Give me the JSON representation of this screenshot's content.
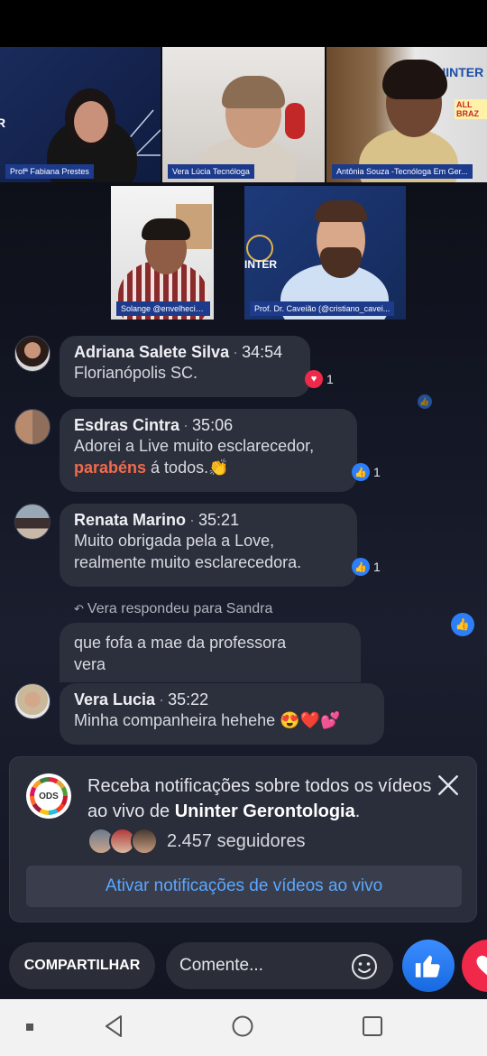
{
  "videos": [
    {
      "label": "Profª Fabiana Prestes"
    },
    {
      "label": "Vera Lúcia Tecnóloga"
    },
    {
      "label": "Antônia Souza -Tecnóloga Em Ger..."
    },
    {
      "label": "Solange @envelheciativo"
    },
    {
      "label": "Prof. Dr. Caveião (@cristiano_cavei..."
    }
  ],
  "brand": {
    "logo_text": "UNINTER",
    "banner_text": "ALL BRAZ"
  },
  "comments": [
    {
      "author": "Adriana Salete Silva",
      "time": "34:54",
      "text": "Florianópolis SC.",
      "reaction_icon": "heart-icon",
      "reaction_count": "1"
    },
    {
      "author": "Esdras Cintra",
      "time": "35:06",
      "text_line1": "Adorei a Live muito esclarecedor,",
      "highlight": "parabéns",
      "text_line2_rest": " á todos.👏",
      "reaction_icon": "like-icon",
      "reaction_count": "1"
    },
    {
      "author": "Renata Marino",
      "time": "35:21",
      "text_line1": "Muito obrigada pela a Love,",
      "text_line2": "realmente muito esclarecedora.",
      "reaction_icon": "like-icon",
      "reaction_count": "1"
    },
    {
      "reply_note": "Vera respondeu para Sandra",
      "text_line1": "que fofa a mae da professora",
      "text_line2": "vera"
    },
    {
      "author": "Vera Lucia",
      "time": "35:22",
      "text": "Minha companheira hehehe 😍❤️💕"
    }
  ],
  "separator": "·",
  "notification": {
    "text_before": "Receba notificações sobre todos os vídeos ao vivo de ",
    "page_name": "Uninter Gerontologia",
    "text_after": ".",
    "followers": "2.457 seguidores",
    "button": "Ativar notificações de vídeos ao vivo",
    "logo_text": "ODS"
  },
  "bottom": {
    "share_label": "COMPARTILHAR",
    "comment_placeholder": "Comente..."
  },
  "colors": {
    "accent": "#2d7ff9",
    "love": "#f0284a",
    "link": "#5aa7ff",
    "highlight": "#f26a4b"
  }
}
